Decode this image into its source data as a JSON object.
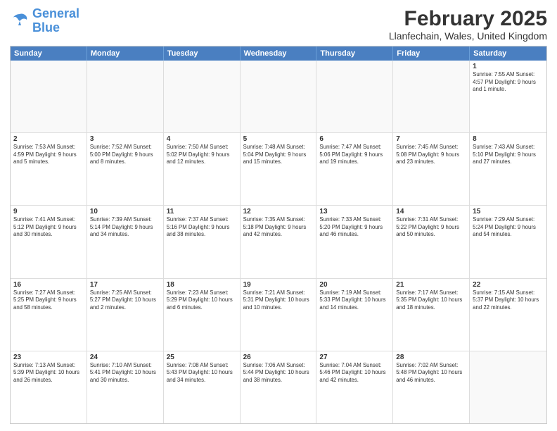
{
  "logo": {
    "line1": "General",
    "line2": "Blue"
  },
  "title": "February 2025",
  "subtitle": "Llanfechain, Wales, United Kingdom",
  "weekdays": [
    "Sunday",
    "Monday",
    "Tuesday",
    "Wednesday",
    "Thursday",
    "Friday",
    "Saturday"
  ],
  "weeks": [
    [
      {
        "day": "",
        "info": ""
      },
      {
        "day": "",
        "info": ""
      },
      {
        "day": "",
        "info": ""
      },
      {
        "day": "",
        "info": ""
      },
      {
        "day": "",
        "info": ""
      },
      {
        "day": "",
        "info": ""
      },
      {
        "day": "1",
        "info": "Sunrise: 7:55 AM\nSunset: 4:57 PM\nDaylight: 9 hours and 1 minute."
      }
    ],
    [
      {
        "day": "2",
        "info": "Sunrise: 7:53 AM\nSunset: 4:59 PM\nDaylight: 9 hours and 5 minutes."
      },
      {
        "day": "3",
        "info": "Sunrise: 7:52 AM\nSunset: 5:00 PM\nDaylight: 9 hours and 8 minutes."
      },
      {
        "day": "4",
        "info": "Sunrise: 7:50 AM\nSunset: 5:02 PM\nDaylight: 9 hours and 12 minutes."
      },
      {
        "day": "5",
        "info": "Sunrise: 7:48 AM\nSunset: 5:04 PM\nDaylight: 9 hours and 15 minutes."
      },
      {
        "day": "6",
        "info": "Sunrise: 7:47 AM\nSunset: 5:06 PM\nDaylight: 9 hours and 19 minutes."
      },
      {
        "day": "7",
        "info": "Sunrise: 7:45 AM\nSunset: 5:08 PM\nDaylight: 9 hours and 23 minutes."
      },
      {
        "day": "8",
        "info": "Sunrise: 7:43 AM\nSunset: 5:10 PM\nDaylight: 9 hours and 27 minutes."
      }
    ],
    [
      {
        "day": "9",
        "info": "Sunrise: 7:41 AM\nSunset: 5:12 PM\nDaylight: 9 hours and 30 minutes."
      },
      {
        "day": "10",
        "info": "Sunrise: 7:39 AM\nSunset: 5:14 PM\nDaylight: 9 hours and 34 minutes."
      },
      {
        "day": "11",
        "info": "Sunrise: 7:37 AM\nSunset: 5:16 PM\nDaylight: 9 hours and 38 minutes."
      },
      {
        "day": "12",
        "info": "Sunrise: 7:35 AM\nSunset: 5:18 PM\nDaylight: 9 hours and 42 minutes."
      },
      {
        "day": "13",
        "info": "Sunrise: 7:33 AM\nSunset: 5:20 PM\nDaylight: 9 hours and 46 minutes."
      },
      {
        "day": "14",
        "info": "Sunrise: 7:31 AM\nSunset: 5:22 PM\nDaylight: 9 hours and 50 minutes."
      },
      {
        "day": "15",
        "info": "Sunrise: 7:29 AM\nSunset: 5:24 PM\nDaylight: 9 hours and 54 minutes."
      }
    ],
    [
      {
        "day": "16",
        "info": "Sunrise: 7:27 AM\nSunset: 5:25 PM\nDaylight: 9 hours and 58 minutes."
      },
      {
        "day": "17",
        "info": "Sunrise: 7:25 AM\nSunset: 5:27 PM\nDaylight: 10 hours and 2 minutes."
      },
      {
        "day": "18",
        "info": "Sunrise: 7:23 AM\nSunset: 5:29 PM\nDaylight: 10 hours and 6 minutes."
      },
      {
        "day": "19",
        "info": "Sunrise: 7:21 AM\nSunset: 5:31 PM\nDaylight: 10 hours and 10 minutes."
      },
      {
        "day": "20",
        "info": "Sunrise: 7:19 AM\nSunset: 5:33 PM\nDaylight: 10 hours and 14 minutes."
      },
      {
        "day": "21",
        "info": "Sunrise: 7:17 AM\nSunset: 5:35 PM\nDaylight: 10 hours and 18 minutes."
      },
      {
        "day": "22",
        "info": "Sunrise: 7:15 AM\nSunset: 5:37 PM\nDaylight: 10 hours and 22 minutes."
      }
    ],
    [
      {
        "day": "23",
        "info": "Sunrise: 7:13 AM\nSunset: 5:39 PM\nDaylight: 10 hours and 26 minutes."
      },
      {
        "day": "24",
        "info": "Sunrise: 7:10 AM\nSunset: 5:41 PM\nDaylight: 10 hours and 30 minutes."
      },
      {
        "day": "25",
        "info": "Sunrise: 7:08 AM\nSunset: 5:43 PM\nDaylight: 10 hours and 34 minutes."
      },
      {
        "day": "26",
        "info": "Sunrise: 7:06 AM\nSunset: 5:44 PM\nDaylight: 10 hours and 38 minutes."
      },
      {
        "day": "27",
        "info": "Sunrise: 7:04 AM\nSunset: 5:46 PM\nDaylight: 10 hours and 42 minutes."
      },
      {
        "day": "28",
        "info": "Sunrise: 7:02 AM\nSunset: 5:48 PM\nDaylight: 10 hours and 46 minutes."
      },
      {
        "day": "",
        "info": ""
      }
    ]
  ]
}
